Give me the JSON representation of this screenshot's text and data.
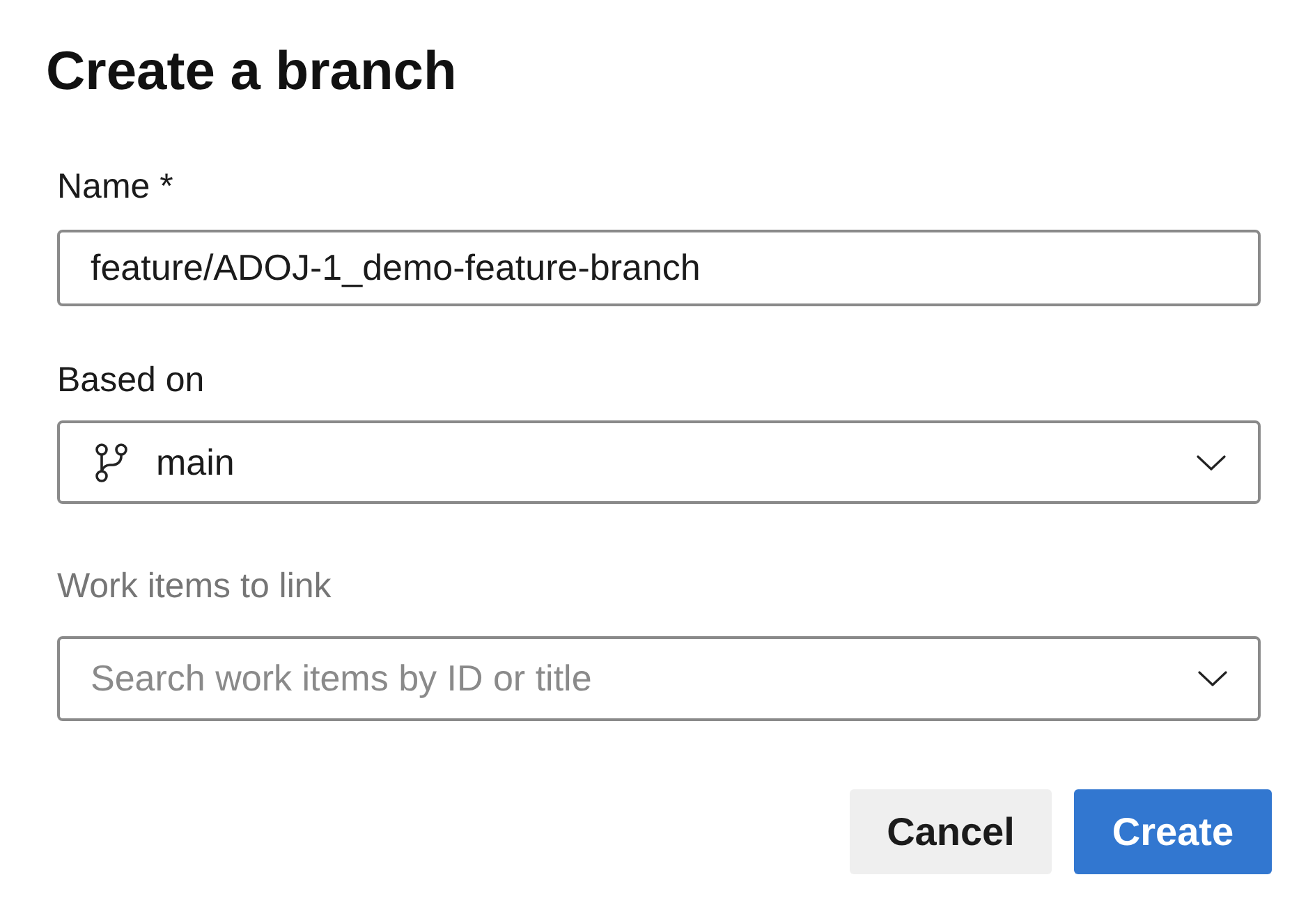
{
  "dialog": {
    "title": "Create a branch"
  },
  "name_field": {
    "label": "Name *",
    "value": "feature/ADOJ-1_demo-feature-branch"
  },
  "based_on": {
    "label": "Based on",
    "value": "main"
  },
  "work_items": {
    "label": "Work items to link",
    "placeholder": "Search work items by ID or title"
  },
  "buttons": [
    {
      "label": "Cancel",
      "kind": "secondary"
    },
    {
      "label": "Create",
      "kind": "primary"
    }
  ]
}
